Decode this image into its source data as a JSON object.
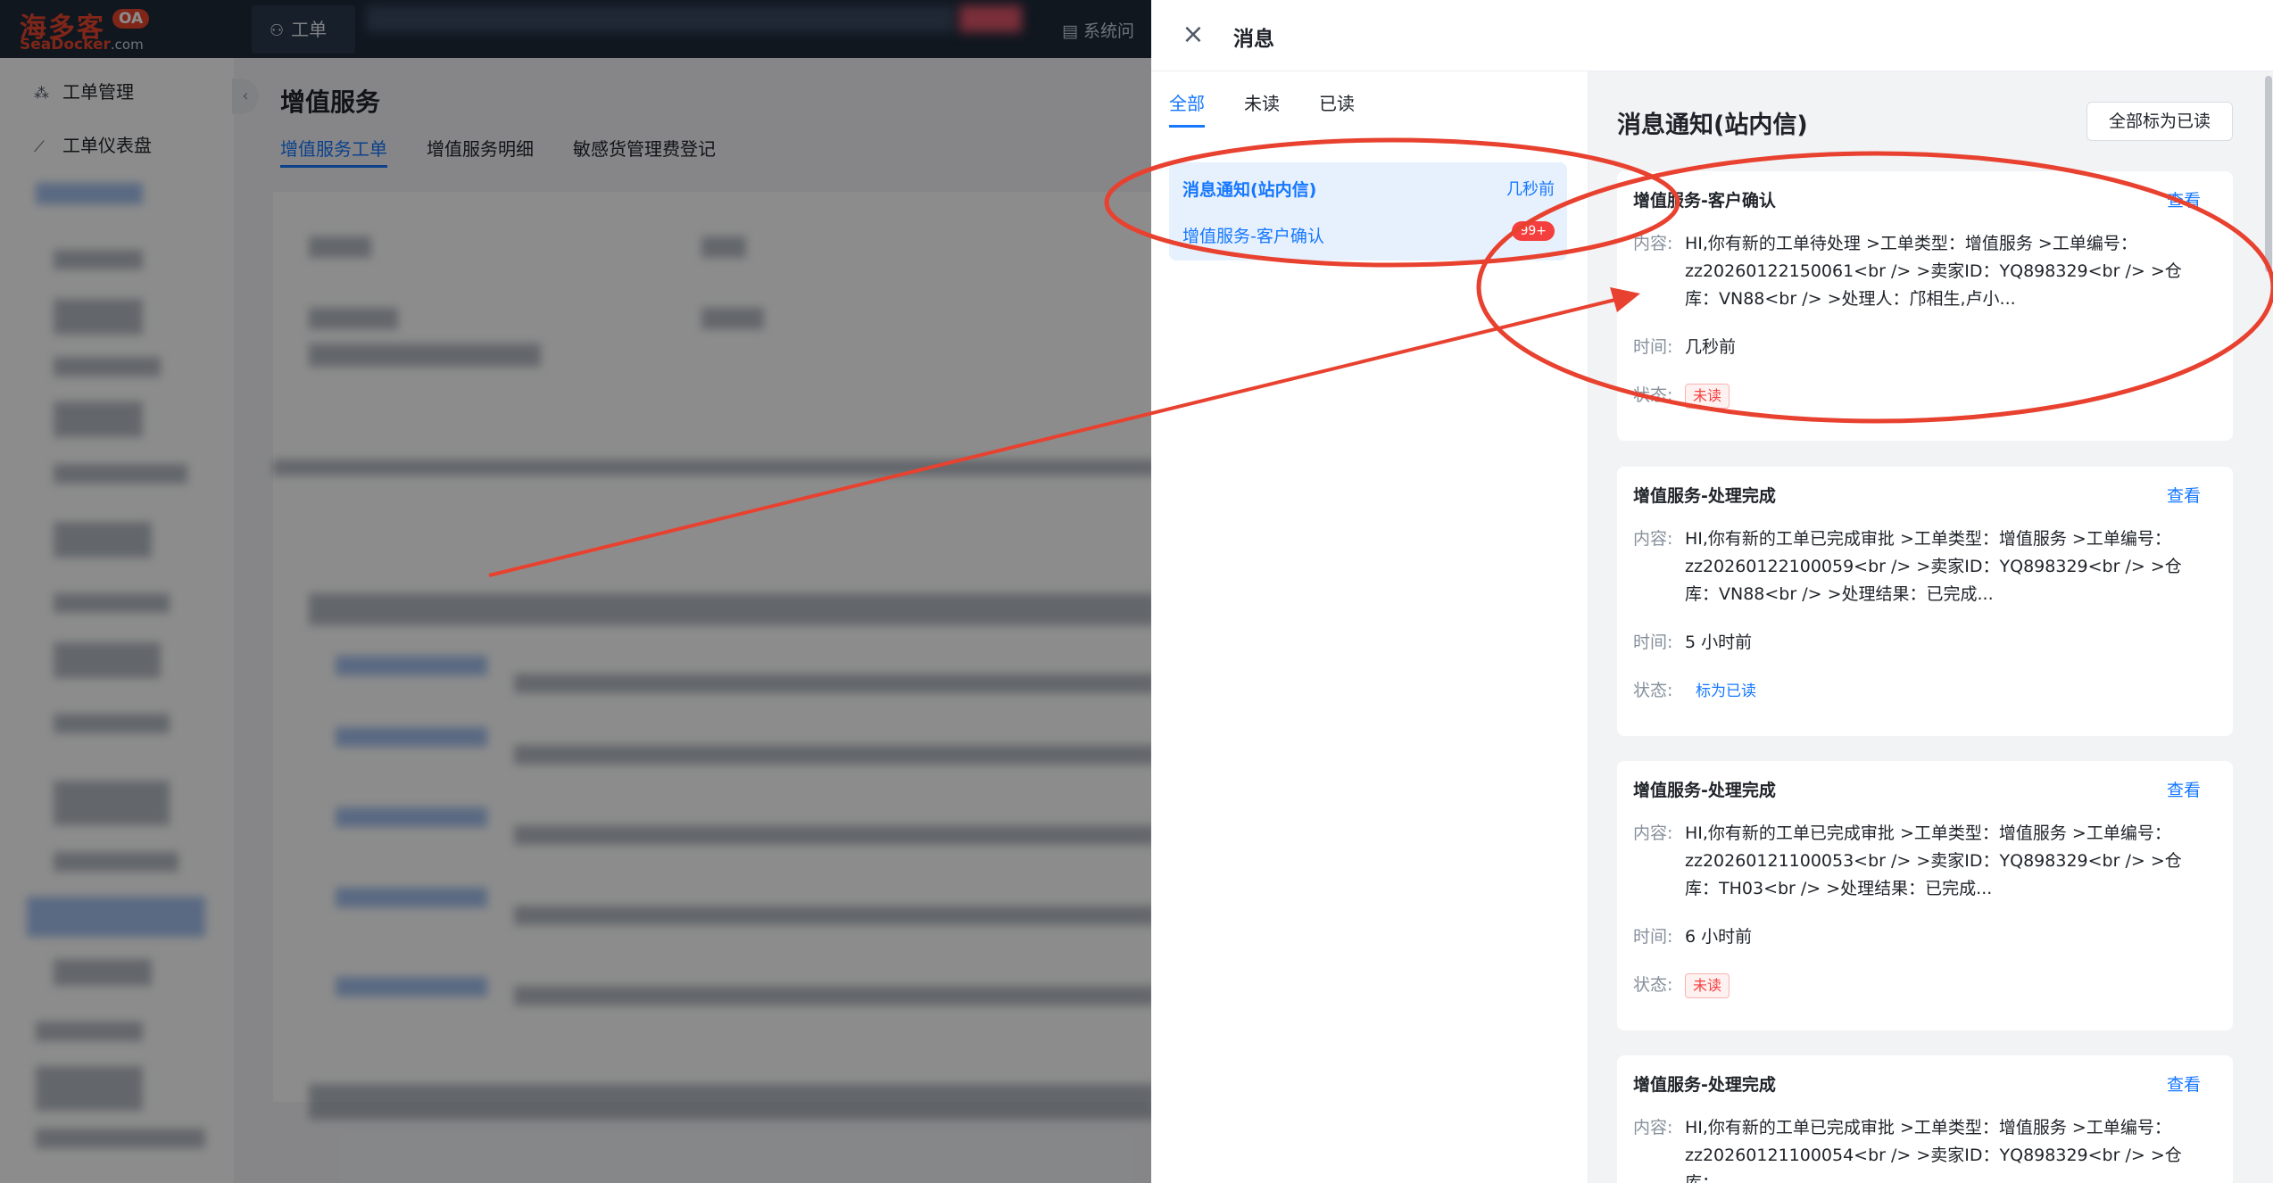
{
  "app": {
    "logo_cn": "海多客",
    "logo_badge": "OA",
    "logo_en": "SeaDocker",
    "logo_domain": ".com",
    "top_tab": "工单",
    "top_right": "系统问"
  },
  "sidebar": {
    "items": [
      {
        "label": "工单管理",
        "icon": "share-nodes-icon"
      },
      {
        "label": "工单仪表盘",
        "icon": "line-chart-icon"
      }
    ]
  },
  "main": {
    "title": "增值服务",
    "tabs": [
      {
        "label": "增值服务工单",
        "active": true
      },
      {
        "label": "增值服务明细",
        "active": false
      },
      {
        "label": "敏感货管理费登记",
        "active": false
      }
    ]
  },
  "drawer": {
    "title": "消息",
    "close_icon": "close-icon",
    "filters": [
      {
        "label": "全部",
        "active": true
      },
      {
        "label": "未读",
        "active": false
      },
      {
        "label": "已读",
        "active": false
      }
    ],
    "group": {
      "title": "消息通知(站内信)",
      "time": "几秒前",
      "sub": "增值服务-客户确认",
      "badge": "99+"
    },
    "panel_title": "消息通知(站内信)",
    "mark_all_label": "全部标为已读",
    "labels": {
      "content": "内容:",
      "time": "时间:",
      "status": "状态:",
      "view": "查看"
    },
    "notifications": [
      {
        "title": "增值服务-客户确认",
        "content": "HI,你有新的工单待处理 >工单类型：增值服务 >工单编号：zz20260122150061<br /> >卖家ID：YQ898329<br /> >仓库：VN88<br /> >处理人：邝相生,卢小...",
        "time": "几秒前",
        "status": "未读",
        "status_type": "tag"
      },
      {
        "title": "增值服务-处理完成",
        "content": "HI,你有新的工单已完成审批 >工单类型：增值服务 >工单编号：zz20260122100059<br /> >卖家ID：YQ898329<br /> >仓库：VN88<br /> >处理结果：已完成...",
        "time": "5 小时前",
        "status": "标为已读",
        "status_type": "link"
      },
      {
        "title": "增值服务-处理完成",
        "content": "HI,你有新的工单已完成审批 >工单类型：增值服务 >工单编号：zz20260121100053<br /> >卖家ID：YQ898329<br /> >仓库：TH03<br /> >处理结果：已完成...",
        "time": "6 小时前",
        "status": "未读",
        "status_type": "tag"
      },
      {
        "title": "增值服务-处理完成",
        "content": "HI,你有新的工单已完成审批 >工单类型：增值服务 >工单编号：zz20260121100054<br /> >卖家ID：YQ898329<br /> >仓库：",
        "time": "",
        "status": "",
        "status_type": "none"
      }
    ]
  },
  "colors": {
    "accent": "#1677ff",
    "annotation": "#e8412f",
    "unread": "#f53f3f",
    "topbar": "#1e2a3a"
  }
}
